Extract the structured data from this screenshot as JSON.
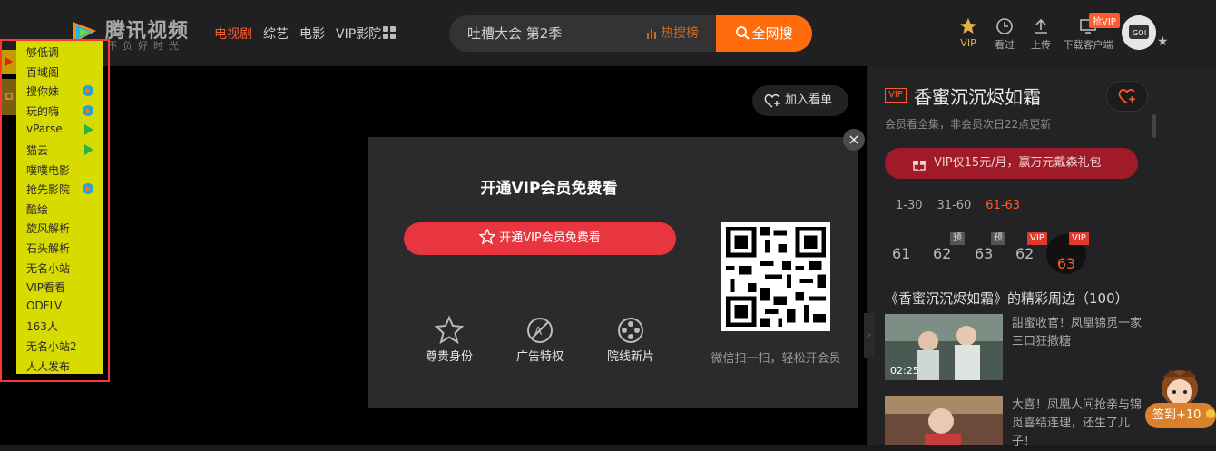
{
  "brand": {
    "name": "腾讯视频",
    "slogan": "不负好时光"
  },
  "nav": {
    "items": [
      {
        "label": "电视剧",
        "active": true
      },
      {
        "label": "综艺",
        "active": false
      },
      {
        "label": "电影",
        "active": false
      },
      {
        "label": "VIP影院",
        "active": false
      }
    ]
  },
  "search": {
    "value": "吐槽大会 第2季",
    "hot_label": "热搜榜",
    "button_label": "全网搜"
  },
  "toolbar": {
    "vip": "VIP",
    "history": "看过",
    "upload": "上传",
    "download": "下载客户端",
    "vip_badge": "抢VIP",
    "avatar_text": "GO!"
  },
  "player": {
    "watchlater_label": "加入看单"
  },
  "modal": {
    "close": "×",
    "title": "开通VIP会员免费看",
    "button_label": "开通VIP会员免费看",
    "perks": [
      "尊贵身份",
      "广告特权",
      "院线新片"
    ],
    "qr_caption": "微信扫一扫，轻松开会员"
  },
  "show": {
    "vip_tag": "VIP",
    "title": "香蜜沉沉烬如霜",
    "update_note": "会员看全集，非会员次日22点更新",
    "promo": "VIP仅15元/月，赢万元戴森礼包",
    "ranges": [
      {
        "label": "1-30",
        "active": false
      },
      {
        "label": "31-60",
        "active": false
      },
      {
        "label": "61-63",
        "active": true
      }
    ],
    "episodes": [
      {
        "num": "61",
        "badge": ""
      },
      {
        "num": "62",
        "badge": "预"
      },
      {
        "num": "63",
        "badge": "预"
      },
      {
        "num": "62",
        "badge": "VIP"
      },
      {
        "num": "63",
        "badge": "VIP"
      }
    ],
    "section_title": "《香蜜沉沉烬如霜》的精彩周边（100）",
    "clips": [
      {
        "title": "甜蜜收官！凤凰锦觅一家三口狂撒糖",
        "duration": "02:25"
      },
      {
        "title": "大喜！凤凰人间抢亲与锦觅喜结连理，还生了儿子！",
        "duration": ""
      }
    ],
    "signin": "签到+10"
  },
  "plugin_menu": {
    "items": [
      {
        "label": "够低调",
        "icon": ""
      },
      {
        "label": "百域阁",
        "icon": ""
      },
      {
        "label": "搜你妹",
        "icon": "video-logo-icon"
      },
      {
        "label": "玩的嗨",
        "icon": "video-logo-icon"
      },
      {
        "label": "vParse",
        "icon": "play-icon"
      },
      {
        "label": "猫云",
        "icon": "play-icon"
      },
      {
        "label": "噗噗电影",
        "icon": ""
      },
      {
        "label": "抢先影院",
        "icon": "video-logo-icon"
      },
      {
        "label": "酷绘",
        "icon": ""
      },
      {
        "label": "旋风解析",
        "icon": ""
      },
      {
        "label": "石头解析",
        "icon": ""
      },
      {
        "label": "无名小站",
        "icon": ""
      },
      {
        "label": "VIP看看",
        "icon": ""
      },
      {
        "label": "ODFLV",
        "icon": ""
      },
      {
        "label": "163人",
        "icon": ""
      },
      {
        "label": "无名小站2",
        "icon": ""
      },
      {
        "label": "人人发布",
        "icon": ""
      }
    ]
  },
  "colors": {
    "accent": "#ff5a2c",
    "search_button": "#ff6c0d",
    "vip_button": "#e8353f",
    "plugin_bg": "#d7db00",
    "highlight": "#ff3636"
  }
}
